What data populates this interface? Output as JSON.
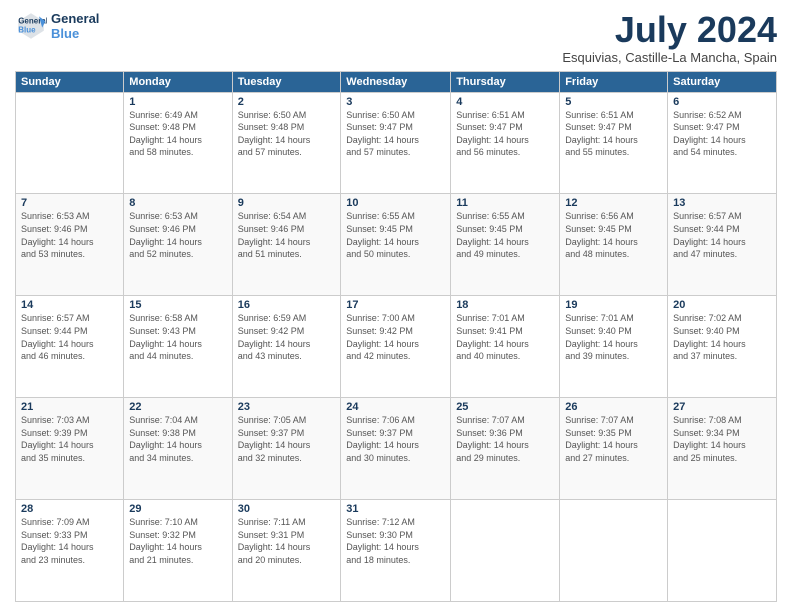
{
  "logo": {
    "line1": "General",
    "line2": "Blue"
  },
  "title": "July 2024",
  "subtitle": "Esquivias, Castille-La Mancha, Spain",
  "days_header": [
    "Sunday",
    "Monday",
    "Tuesday",
    "Wednesday",
    "Thursday",
    "Friday",
    "Saturday"
  ],
  "weeks": [
    [
      {
        "day": "",
        "info": ""
      },
      {
        "day": "1",
        "info": "Sunrise: 6:49 AM\nSunset: 9:48 PM\nDaylight: 14 hours\nand 58 minutes."
      },
      {
        "day": "2",
        "info": "Sunrise: 6:50 AM\nSunset: 9:48 PM\nDaylight: 14 hours\nand 57 minutes."
      },
      {
        "day": "3",
        "info": "Sunrise: 6:50 AM\nSunset: 9:47 PM\nDaylight: 14 hours\nand 57 minutes."
      },
      {
        "day": "4",
        "info": "Sunrise: 6:51 AM\nSunset: 9:47 PM\nDaylight: 14 hours\nand 56 minutes."
      },
      {
        "day": "5",
        "info": "Sunrise: 6:51 AM\nSunset: 9:47 PM\nDaylight: 14 hours\nand 55 minutes."
      },
      {
        "day": "6",
        "info": "Sunrise: 6:52 AM\nSunset: 9:47 PM\nDaylight: 14 hours\nand 54 minutes."
      }
    ],
    [
      {
        "day": "7",
        "info": "Sunrise: 6:53 AM\nSunset: 9:46 PM\nDaylight: 14 hours\nand 53 minutes."
      },
      {
        "day": "8",
        "info": "Sunrise: 6:53 AM\nSunset: 9:46 PM\nDaylight: 14 hours\nand 52 minutes."
      },
      {
        "day": "9",
        "info": "Sunrise: 6:54 AM\nSunset: 9:46 PM\nDaylight: 14 hours\nand 51 minutes."
      },
      {
        "day": "10",
        "info": "Sunrise: 6:55 AM\nSunset: 9:45 PM\nDaylight: 14 hours\nand 50 minutes."
      },
      {
        "day": "11",
        "info": "Sunrise: 6:55 AM\nSunset: 9:45 PM\nDaylight: 14 hours\nand 49 minutes."
      },
      {
        "day": "12",
        "info": "Sunrise: 6:56 AM\nSunset: 9:45 PM\nDaylight: 14 hours\nand 48 minutes."
      },
      {
        "day": "13",
        "info": "Sunrise: 6:57 AM\nSunset: 9:44 PM\nDaylight: 14 hours\nand 47 minutes."
      }
    ],
    [
      {
        "day": "14",
        "info": "Sunrise: 6:57 AM\nSunset: 9:44 PM\nDaylight: 14 hours\nand 46 minutes."
      },
      {
        "day": "15",
        "info": "Sunrise: 6:58 AM\nSunset: 9:43 PM\nDaylight: 14 hours\nand 44 minutes."
      },
      {
        "day": "16",
        "info": "Sunrise: 6:59 AM\nSunset: 9:42 PM\nDaylight: 14 hours\nand 43 minutes."
      },
      {
        "day": "17",
        "info": "Sunrise: 7:00 AM\nSunset: 9:42 PM\nDaylight: 14 hours\nand 42 minutes."
      },
      {
        "day": "18",
        "info": "Sunrise: 7:01 AM\nSunset: 9:41 PM\nDaylight: 14 hours\nand 40 minutes."
      },
      {
        "day": "19",
        "info": "Sunrise: 7:01 AM\nSunset: 9:40 PM\nDaylight: 14 hours\nand 39 minutes."
      },
      {
        "day": "20",
        "info": "Sunrise: 7:02 AM\nSunset: 9:40 PM\nDaylight: 14 hours\nand 37 minutes."
      }
    ],
    [
      {
        "day": "21",
        "info": "Sunrise: 7:03 AM\nSunset: 9:39 PM\nDaylight: 14 hours\nand 35 minutes."
      },
      {
        "day": "22",
        "info": "Sunrise: 7:04 AM\nSunset: 9:38 PM\nDaylight: 14 hours\nand 34 minutes."
      },
      {
        "day": "23",
        "info": "Sunrise: 7:05 AM\nSunset: 9:37 PM\nDaylight: 14 hours\nand 32 minutes."
      },
      {
        "day": "24",
        "info": "Sunrise: 7:06 AM\nSunset: 9:37 PM\nDaylight: 14 hours\nand 30 minutes."
      },
      {
        "day": "25",
        "info": "Sunrise: 7:07 AM\nSunset: 9:36 PM\nDaylight: 14 hours\nand 29 minutes."
      },
      {
        "day": "26",
        "info": "Sunrise: 7:07 AM\nSunset: 9:35 PM\nDaylight: 14 hours\nand 27 minutes."
      },
      {
        "day": "27",
        "info": "Sunrise: 7:08 AM\nSunset: 9:34 PM\nDaylight: 14 hours\nand 25 minutes."
      }
    ],
    [
      {
        "day": "28",
        "info": "Sunrise: 7:09 AM\nSunset: 9:33 PM\nDaylight: 14 hours\nand 23 minutes."
      },
      {
        "day": "29",
        "info": "Sunrise: 7:10 AM\nSunset: 9:32 PM\nDaylight: 14 hours\nand 21 minutes."
      },
      {
        "day": "30",
        "info": "Sunrise: 7:11 AM\nSunset: 9:31 PM\nDaylight: 14 hours\nand 20 minutes."
      },
      {
        "day": "31",
        "info": "Sunrise: 7:12 AM\nSunset: 9:30 PM\nDaylight: 14 hours\nand 18 minutes."
      },
      {
        "day": "",
        "info": ""
      },
      {
        "day": "",
        "info": ""
      },
      {
        "day": "",
        "info": ""
      }
    ]
  ]
}
